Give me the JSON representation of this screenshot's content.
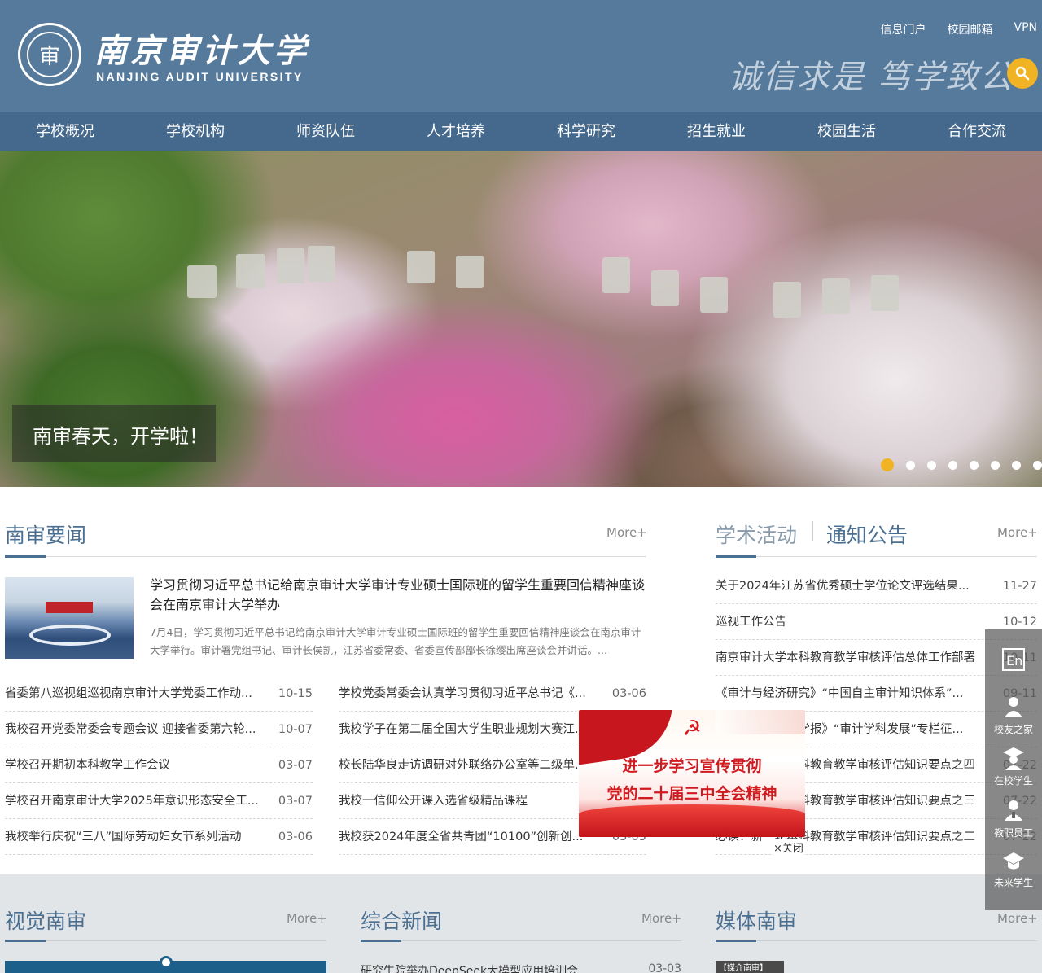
{
  "header": {
    "university_cn": "南京审计大学",
    "university_en": "NANJING AUDIT UNIVERSITY",
    "emblem_char": "审",
    "motto": "诚信求是 笃学致公",
    "top_links": [
      "信息门户",
      "校园邮箱",
      "VPN"
    ]
  },
  "nav": [
    "学校概况",
    "学校机构",
    "师资队伍",
    "人才培养",
    "科学研究",
    "招生就业",
    "校园生活",
    "合作交流"
  ],
  "banner": {
    "caption": "南审春天，开学啦！",
    "slide_count": 8,
    "active_slide": 1
  },
  "news": {
    "title": "南审要闻",
    "more": "More+",
    "featured": {
      "title": "学习贯彻习近平总书记给南京审计大学审计专业硕士国际班的留学生重要回信精神座谈会在南京审计大学举办",
      "desc": "7月4日，学习贯彻习近平总书记给南京审计大学审计专业硕士国际班的留学生重要回信精神座谈会在南京审计大学举行。审计署党组书记、审计长侯凯，江苏省委常委、省委宣传部部长徐缨出席座谈会并讲话。..."
    },
    "left_list": [
      {
        "title": "省委第八巡视组巡视南京审计大学党委工作动...",
        "date": "10-15"
      },
      {
        "title": "我校召开党委常委会专题会议 迎接省委第六轮...",
        "date": "10-07"
      },
      {
        "title": "学校召开期初本科教学工作会议",
        "date": "03-07"
      },
      {
        "title": "学校召开南京审计大学2025年意识形态安全工...",
        "date": "03-07"
      },
      {
        "title": "我校举行庆祝“三八”国际劳动妇女节系列活动",
        "date": "03-06"
      }
    ],
    "right_list": [
      {
        "title": "学校党委常委会认真学习贯彻习近平总书记《...",
        "date": "03-06"
      },
      {
        "title": "我校学子在第二届全国大学生职业规划大赛江...",
        "date": ""
      },
      {
        "title": "校长陆华良走访调研对外联络办公室等二级单...",
        "date": ""
      },
      {
        "title": "我校一信仰公开课入选省级精品课程",
        "date": ""
      },
      {
        "title": "我校获2024年度全省共青团“10100”创新创...",
        "date": "03-05"
      }
    ]
  },
  "notices": {
    "tab_academic": "学术活动",
    "tab_notice": "通知公告",
    "more": "More+",
    "items": [
      {
        "title": "关于2024年江苏省优秀硕士学位论文评选结果...",
        "date": "11-27"
      },
      {
        "title": "巡视工作公告",
        "date": "10-12"
      },
      {
        "title": "南京审计大学本科教育教学审核评估总体工作部署",
        "date": "10-11"
      },
      {
        "title": "《审计与经济研究》“中国自主审计知识体系”...",
        "date": "09-11"
      },
      {
        "title": "《南京审计大学学报》“审计学科发展”专栏征...",
        "date": ""
      },
      {
        "title": "必读：新一轮本科教育教学审核评估知识要点之四",
        "date": "07-22"
      },
      {
        "title": "必读：新一轮本科教育教学审核评估知识要点之三",
        "date": "07-22"
      },
      {
        "title": "必读：新一轮本科教育教学审核评估知识要点之二",
        "date": "07-22"
      }
    ]
  },
  "popup": {
    "line1": "进一步学习宣传贯彻",
    "line2": "党的二十届三中全会精神",
    "close": "×关闭"
  },
  "sidebar": {
    "en_label": "En",
    "items": [
      "校友之家",
      "在校学生",
      "教职员工",
      "未来学生"
    ]
  },
  "bottom": {
    "visual": {
      "title": "视觉南审",
      "more": "More+"
    },
    "general": {
      "title": "综合新闻",
      "more": "More+",
      "first_item": "研究生院举办DeepSeek大模型应用培训会",
      "first_date": "03-03"
    },
    "media": {
      "title": "媒体南审",
      "more": "More+",
      "tag": "【媒介南审】"
    }
  },
  "colors": {
    "header_bg": "#557a9c",
    "nav_bg": "#44698c",
    "accent": "#4b6f91",
    "search_btn": "#f0b323"
  }
}
